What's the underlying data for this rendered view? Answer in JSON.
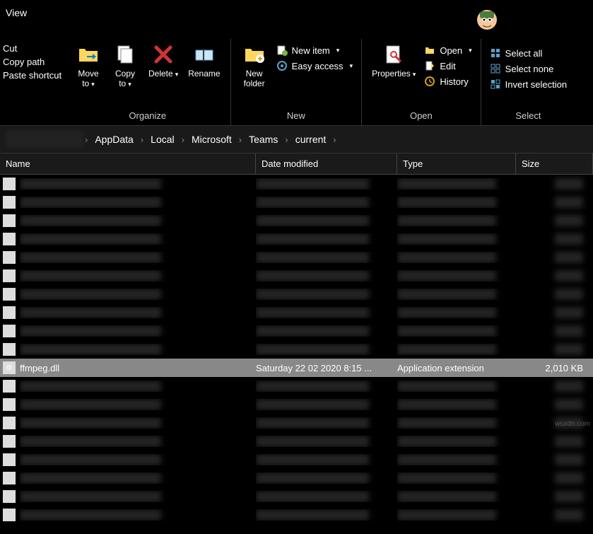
{
  "titlebar": {
    "view": "View"
  },
  "clipboard": {
    "cut": "Cut",
    "copy_path": "Copy path",
    "paste_shortcut": "Paste shortcut"
  },
  "organize": {
    "label": "Organize",
    "move_to": "Move\nto",
    "copy_to": "Copy\nto",
    "delete": "Delete",
    "rename": "Rename"
  },
  "new": {
    "label": "New",
    "new_folder": "New\nfolder",
    "new_item": "New item",
    "easy_access": "Easy access"
  },
  "open": {
    "label": "Open",
    "properties": "Properties",
    "open": "Open",
    "edit": "Edit",
    "history": "History"
  },
  "select": {
    "label": "Select",
    "select_all": "Select all",
    "select_none": "Select none",
    "invert": "Invert selection"
  },
  "breadcrumb": {
    "items": [
      "AppData",
      "Local",
      "Microsoft",
      "Teams",
      "current"
    ]
  },
  "columns": {
    "name": "Name",
    "date": "Date modified",
    "type": "Type",
    "size": "Size"
  },
  "selected_file": {
    "name": "ffmpeg.dll",
    "date": "Saturday 22 02 2020 8:15 ...",
    "type": "Application extension",
    "size": "2,010 KB"
  },
  "watermark": "wsxdn.com"
}
